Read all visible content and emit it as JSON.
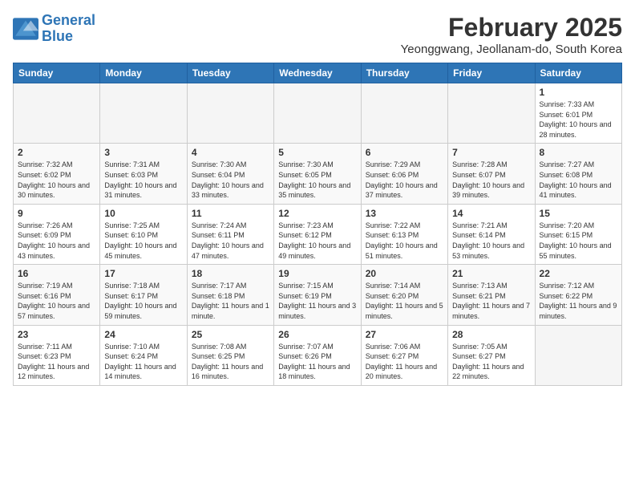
{
  "logo": {
    "line1": "General",
    "line2": "Blue"
  },
  "title": "February 2025",
  "location": "Yeonggwang, Jeollanam-do, South Korea",
  "weekdays": [
    "Sunday",
    "Monday",
    "Tuesday",
    "Wednesday",
    "Thursday",
    "Friday",
    "Saturday"
  ],
  "weeks": [
    [
      {
        "day": "",
        "info": ""
      },
      {
        "day": "",
        "info": ""
      },
      {
        "day": "",
        "info": ""
      },
      {
        "day": "",
        "info": ""
      },
      {
        "day": "",
        "info": ""
      },
      {
        "day": "",
        "info": ""
      },
      {
        "day": "1",
        "info": "Sunrise: 7:33 AM\nSunset: 6:01 PM\nDaylight: 10 hours and 28 minutes."
      }
    ],
    [
      {
        "day": "2",
        "info": "Sunrise: 7:32 AM\nSunset: 6:02 PM\nDaylight: 10 hours and 30 minutes."
      },
      {
        "day": "3",
        "info": "Sunrise: 7:31 AM\nSunset: 6:03 PM\nDaylight: 10 hours and 31 minutes."
      },
      {
        "day": "4",
        "info": "Sunrise: 7:30 AM\nSunset: 6:04 PM\nDaylight: 10 hours and 33 minutes."
      },
      {
        "day": "5",
        "info": "Sunrise: 7:30 AM\nSunset: 6:05 PM\nDaylight: 10 hours and 35 minutes."
      },
      {
        "day": "6",
        "info": "Sunrise: 7:29 AM\nSunset: 6:06 PM\nDaylight: 10 hours and 37 minutes."
      },
      {
        "day": "7",
        "info": "Sunrise: 7:28 AM\nSunset: 6:07 PM\nDaylight: 10 hours and 39 minutes."
      },
      {
        "day": "8",
        "info": "Sunrise: 7:27 AM\nSunset: 6:08 PM\nDaylight: 10 hours and 41 minutes."
      }
    ],
    [
      {
        "day": "9",
        "info": "Sunrise: 7:26 AM\nSunset: 6:09 PM\nDaylight: 10 hours and 43 minutes."
      },
      {
        "day": "10",
        "info": "Sunrise: 7:25 AM\nSunset: 6:10 PM\nDaylight: 10 hours and 45 minutes."
      },
      {
        "day": "11",
        "info": "Sunrise: 7:24 AM\nSunset: 6:11 PM\nDaylight: 10 hours and 47 minutes."
      },
      {
        "day": "12",
        "info": "Sunrise: 7:23 AM\nSunset: 6:12 PM\nDaylight: 10 hours and 49 minutes."
      },
      {
        "day": "13",
        "info": "Sunrise: 7:22 AM\nSunset: 6:13 PM\nDaylight: 10 hours and 51 minutes."
      },
      {
        "day": "14",
        "info": "Sunrise: 7:21 AM\nSunset: 6:14 PM\nDaylight: 10 hours and 53 minutes."
      },
      {
        "day": "15",
        "info": "Sunrise: 7:20 AM\nSunset: 6:15 PM\nDaylight: 10 hours and 55 minutes."
      }
    ],
    [
      {
        "day": "16",
        "info": "Sunrise: 7:19 AM\nSunset: 6:16 PM\nDaylight: 10 hours and 57 minutes."
      },
      {
        "day": "17",
        "info": "Sunrise: 7:18 AM\nSunset: 6:17 PM\nDaylight: 10 hours and 59 minutes."
      },
      {
        "day": "18",
        "info": "Sunrise: 7:17 AM\nSunset: 6:18 PM\nDaylight: 11 hours and 1 minute."
      },
      {
        "day": "19",
        "info": "Sunrise: 7:15 AM\nSunset: 6:19 PM\nDaylight: 11 hours and 3 minutes."
      },
      {
        "day": "20",
        "info": "Sunrise: 7:14 AM\nSunset: 6:20 PM\nDaylight: 11 hours and 5 minutes."
      },
      {
        "day": "21",
        "info": "Sunrise: 7:13 AM\nSunset: 6:21 PM\nDaylight: 11 hours and 7 minutes."
      },
      {
        "day": "22",
        "info": "Sunrise: 7:12 AM\nSunset: 6:22 PM\nDaylight: 11 hours and 9 minutes."
      }
    ],
    [
      {
        "day": "23",
        "info": "Sunrise: 7:11 AM\nSunset: 6:23 PM\nDaylight: 11 hours and 12 minutes."
      },
      {
        "day": "24",
        "info": "Sunrise: 7:10 AM\nSunset: 6:24 PM\nDaylight: 11 hours and 14 minutes."
      },
      {
        "day": "25",
        "info": "Sunrise: 7:08 AM\nSunset: 6:25 PM\nDaylight: 11 hours and 16 minutes."
      },
      {
        "day": "26",
        "info": "Sunrise: 7:07 AM\nSunset: 6:26 PM\nDaylight: 11 hours and 18 minutes."
      },
      {
        "day": "27",
        "info": "Sunrise: 7:06 AM\nSunset: 6:27 PM\nDaylight: 11 hours and 20 minutes."
      },
      {
        "day": "28",
        "info": "Sunrise: 7:05 AM\nSunset: 6:27 PM\nDaylight: 11 hours and 22 minutes."
      },
      {
        "day": "",
        "info": ""
      }
    ]
  ]
}
